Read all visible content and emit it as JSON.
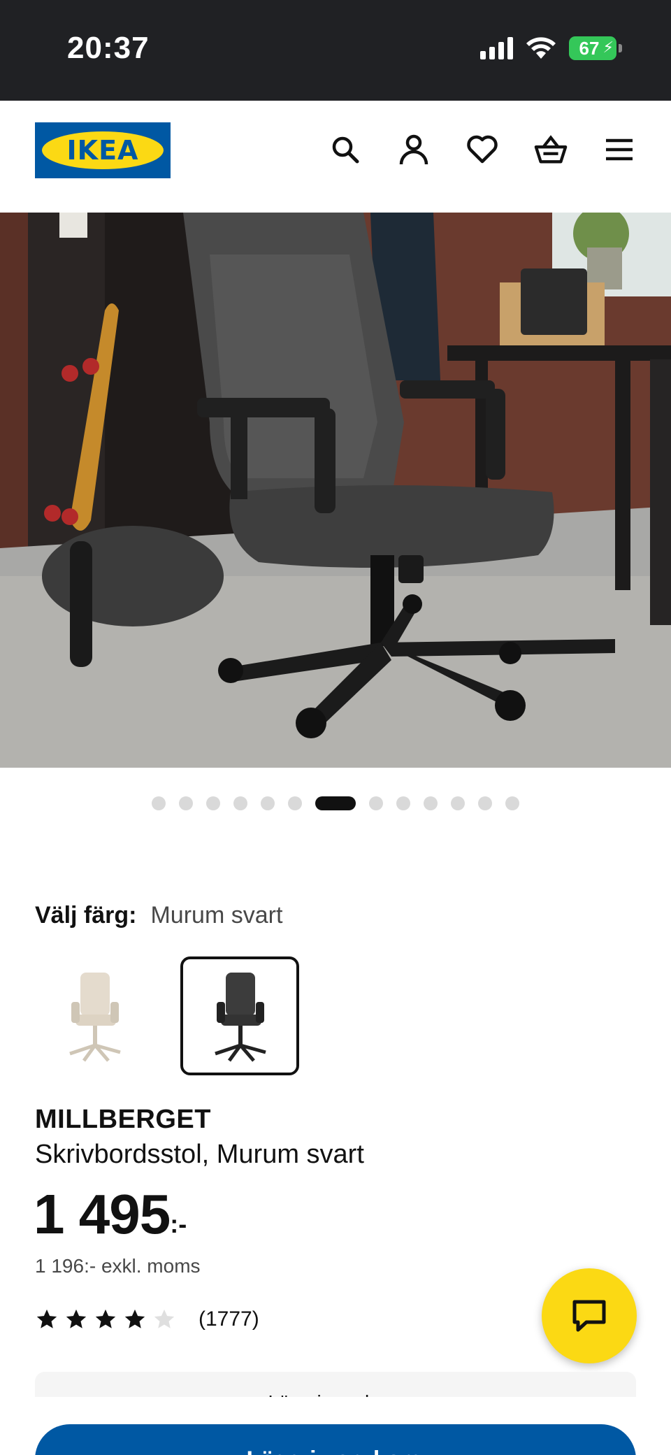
{
  "status_bar": {
    "time": "20:37",
    "battery": "67",
    "icons": [
      "signal-icon",
      "wifi-icon",
      "battery-charging-icon"
    ]
  },
  "header": {
    "logo_text": "IKEA",
    "icons": [
      "search-icon",
      "account-icon",
      "wishlist-heart-icon",
      "shopping-bag-icon",
      "menu-icon"
    ]
  },
  "carousel": {
    "total_images": 13,
    "active_index": 6
  },
  "color_select": {
    "label": "Välj färg:",
    "selected": "Murum svart",
    "options": [
      "Murum beige",
      "Murum svart"
    ],
    "selected_index": 1
  },
  "product": {
    "name": "MILLBERGET",
    "description": "Skrivbordsstol, Murum svart",
    "price": "1 495",
    "price_suffix": ":-",
    "price_excl_vat": "1 196:- exkl. moms",
    "rating": 4,
    "rating_max": 5,
    "review_count": "(1777)"
  },
  "info_box": {
    "text": "Lägg i varukorg"
  },
  "buy_button": {
    "label": "Lägg i varukorg"
  },
  "colors": {
    "ikea_blue": "#0058a3",
    "ikea_yellow": "#fbd914",
    "status_bar_bg": "#202124",
    "battery_green": "#34c759"
  }
}
